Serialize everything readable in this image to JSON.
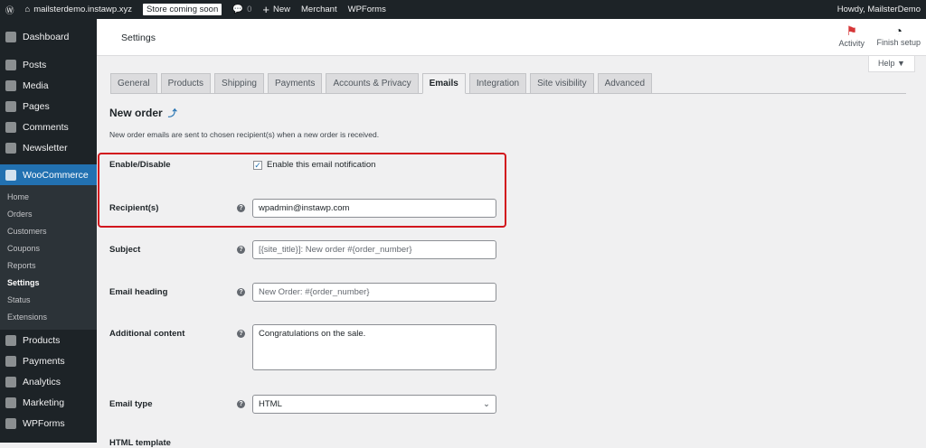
{
  "adminbar": {
    "site": "mailsterdemo.instawp.xyz",
    "badge": "Store coming soon",
    "comments": "0",
    "new": "New",
    "merchant": "Merchant",
    "wpforms": "WPForms",
    "howdy": "Howdy, MailsterDemo"
  },
  "sidebar": {
    "top": [
      "Dashboard",
      "Posts",
      "Media",
      "Pages",
      "Comments",
      "Newsletter"
    ],
    "woo": "WooCommerce",
    "sub": [
      "Home",
      "Orders",
      "Customers",
      "Coupons",
      "Reports",
      "Settings",
      "Status",
      "Extensions"
    ],
    "bottom": [
      "Products",
      "Payments",
      "Analytics",
      "Marketing",
      "WPForms"
    ]
  },
  "header": {
    "title": "Settings",
    "activity": "Activity",
    "finish": "Finish setup",
    "help": "Help ▼"
  },
  "tabs": [
    "General",
    "Products",
    "Shipping",
    "Payments",
    "Accounts & Privacy",
    "Emails",
    "Integration",
    "Site visibility",
    "Advanced"
  ],
  "section": {
    "title": "New order",
    "desc": "New order emails are sent to chosen recipient(s) when a new order is received."
  },
  "fields": {
    "enable_label": "Enable/Disable",
    "enable_text": "Enable this email notification",
    "recipient_label": "Recipient(s)",
    "recipient_value": "wpadmin@instawp.com",
    "subject_label": "Subject",
    "subject_ph": "[{site_title}]: New order #{order_number}",
    "heading_label": "Email heading",
    "heading_ph": "New Order: #{order_number}",
    "additional_label": "Additional content",
    "additional_value": "Congratulations on the sale.",
    "type_label": "Email type",
    "type_value": "HTML",
    "template_label": "HTML template"
  },
  "colors": {
    "highlight": "#d2161d",
    "accent": "#2271b1"
  }
}
